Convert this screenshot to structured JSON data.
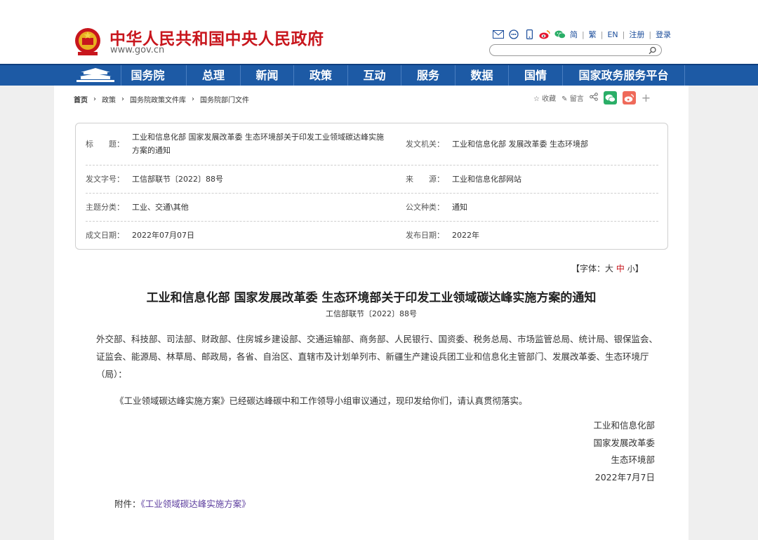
{
  "header": {
    "site_title": "中华人民共和国中央人民政府",
    "site_url": "www.gov.cn",
    "lang_links": [
      "简",
      "繁",
      "EN",
      "注册",
      "登录"
    ],
    "search_placeholder": "",
    "icons": [
      "mail-icon",
      "chat-icon",
      "mobile-icon",
      "weibo-icon",
      "wechat-icon",
      "search-icon"
    ]
  },
  "nav": {
    "items": [
      "国务院",
      "总理",
      "新闻",
      "政策",
      "互动",
      "服务",
      "数据",
      "国情",
      "国家政务服务平台"
    ]
  },
  "breadcrumb": [
    "首页",
    "政策",
    "国务院政策文件库",
    "国务院部门文件"
  ],
  "share": {
    "favorite": "收藏",
    "comment": "留言"
  },
  "info": {
    "title_label": "标　　题：",
    "title_line1": "工业和信息化部 国家发展改革委 生态环境部关于印发工业领域碳达峰实施",
    "title_line2": "方案的通知",
    "issuer_label": "发文机关：",
    "issuer": "工业和信息化部 发展改革委 生态环境部",
    "docno_label": "发文字号：",
    "docno": "工信部联节〔2022〕88号",
    "source_label": "来　　源：",
    "source": "工业和信息化部网站",
    "topic_label": "主题分类：",
    "topic": "工业、交通\\其他",
    "type_label": "公文种类：",
    "type": "通知",
    "written_label": "成文日期：",
    "written": "2022年07月07日",
    "published_label": "发布日期：",
    "published": "2022年"
  },
  "font_size": {
    "prefix": "【字体：",
    "large": "大",
    "medium": "中",
    "small": "小",
    "suffix": "】"
  },
  "article": {
    "title": "工业和信息化部 国家发展改革委 生态环境部关于印发工业领域碳达峰实施方案的通知",
    "doc_no": "工信部联节〔2022〕88号",
    "recipients": "外交部、科技部、司法部、财政部、住房城乡建设部、交通运输部、商务部、人民银行、国资委、税务总局、市场监管总局、统计局、银保监会、证监会、能源局、林草局、邮政局，各省、自治区、直辖市及计划单列市、新疆生产建设兵团工业和信息化主管部门、发展改革委、生态环境厅（局）：",
    "body": "《工业领域碳达峰实施方案》已经碳达峰碳中和工作领导小组审议通过，现印发给你们，请认真贯彻落实。",
    "signers": [
      "工业和信息化部",
      "国家发展改革委",
      "生态环境部"
    ],
    "date": "2022年7月7日",
    "attachment_label": "附件：",
    "attachment_link": "《工业领域碳达峰实施方案》"
  },
  "colors": {
    "brand_red": "#c8161d",
    "nav_blue": "#1d5aa5",
    "link_purple": "#5c3d9e",
    "wechat_green": "#2aae67",
    "weibo_red": "#e6162d"
  }
}
